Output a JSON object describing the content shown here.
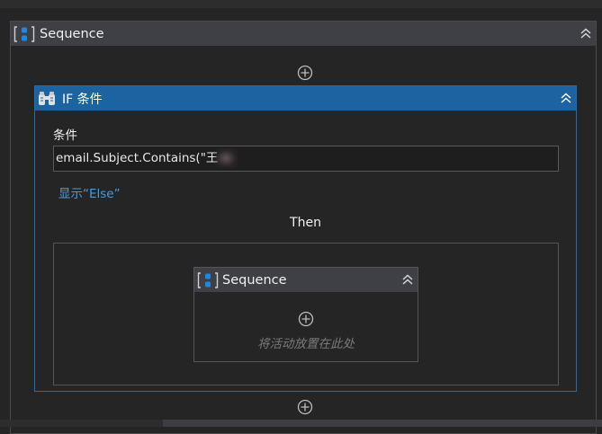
{
  "colors": {
    "background": "#252526",
    "outer_header": "#3f3f46",
    "if_header": "#1c63a1",
    "link": "#4a9bdc",
    "seq_icon": "#1e88e5"
  },
  "outer_sequence": {
    "title": "Sequence",
    "icon": "sequence-icon",
    "collapse_icon": "double-chevron-up-icon"
  },
  "if_activity": {
    "title": "IF 条件",
    "icon": "if-binoculars-icon",
    "condition_label": "条件",
    "condition_value": "email.Subject.Contains(\"王",
    "show_else_link": "显示“Else”",
    "then_label": "Then"
  },
  "inner_sequence": {
    "title": "Sequence",
    "drop_hint": "将活动放置在此处"
  }
}
